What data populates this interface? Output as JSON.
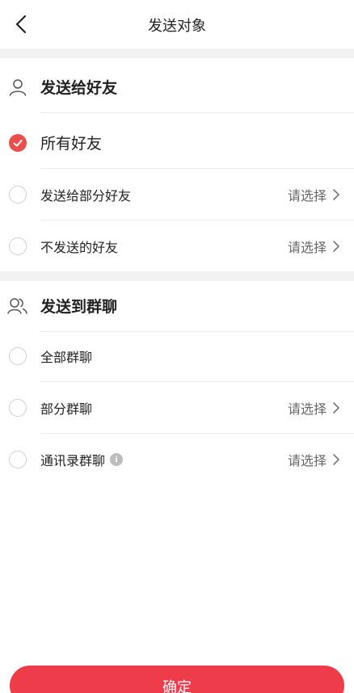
{
  "header": {
    "title": "发送对象"
  },
  "friends_section": {
    "title": "发送给好友",
    "options": [
      {
        "label": "所有好友",
        "checked": true
      },
      {
        "label": "发送给部分好友",
        "action": "请选择",
        "checked": false
      },
      {
        "label": "不发送的好友",
        "action": "请选择",
        "checked": false
      }
    ]
  },
  "groups_section": {
    "title": "发送到群聊",
    "options": [
      {
        "label": "全部群聊",
        "checked": false
      },
      {
        "label": "部分群聊",
        "action": "请选择",
        "checked": false
      },
      {
        "label": "通讯录群聊",
        "action": "请选择",
        "checked": false,
        "info_icon": "i"
      }
    ]
  },
  "footer": {
    "confirm_label": "确定"
  },
  "colors": {
    "accent": "#ec4d4d",
    "button": "#ef3c4b",
    "divider_band": "#f2f2f2"
  },
  "icons": {
    "back": "back-arrow-icon",
    "friend": "person-icon",
    "group": "group-icon",
    "chevron": "chevron-right-icon",
    "info": "info-icon",
    "check": "check-icon"
  }
}
